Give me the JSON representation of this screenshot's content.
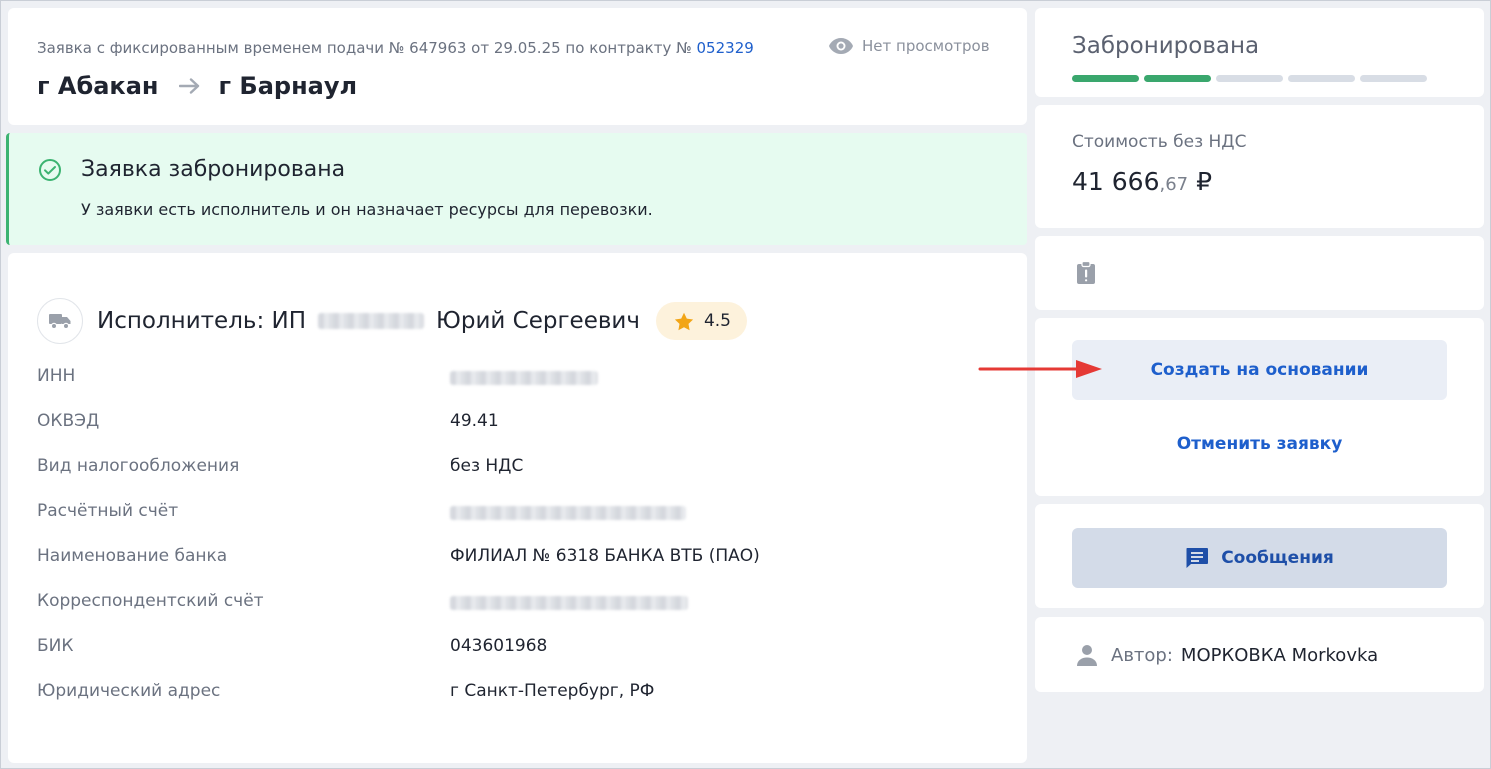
{
  "header": {
    "order_meta": "Заявка с фиксированным временем подачи № 647963 от 29.05.25 по контракту №",
    "contract_number": "052329",
    "views": "Нет просмотров",
    "route_from": "г Абакан",
    "route_to": "г Барнаул"
  },
  "status_banner": {
    "title": "Заявка забронирована",
    "description": "У заявки есть исполнитель и он назначает ресурсы для перевозки."
  },
  "executor": {
    "name_prefix": "Исполнитель: ИП",
    "name_suffix": "Юрий Сергеевич",
    "rating": "4.5",
    "properties": [
      {
        "label": "ИНН",
        "value": ""
      },
      {
        "label": "ОКВЭД",
        "value": "49.41"
      },
      {
        "label": "Вид налогообложения",
        "value": "без НДС"
      },
      {
        "label": "Расчётный счёт",
        "value": ""
      },
      {
        "label": "Наименование банка",
        "value": "ФИЛИАЛ № 6318 БАНКА ВТБ (ПАО)"
      },
      {
        "label": "Корреспондентский счёт",
        "value": ""
      },
      {
        "label": "БИК",
        "value": "043601968"
      },
      {
        "label": "Юридический адрес",
        "value": "г Санкт-Петербург, РФ"
      }
    ]
  },
  "status_panel": {
    "status": "Забронирована",
    "progress_steps_total": 5,
    "progress_steps_done": 2,
    "done_color": "#3aa76d",
    "pending_color": "#d8dde5"
  },
  "price": {
    "label": "Стоимость без НДС",
    "rubles": "41 666",
    "kopecks": ",67",
    "currency": "₽"
  },
  "actions": {
    "create_label": "Создать на основании",
    "cancel_label": "Отменить заявку"
  },
  "messages": {
    "label": "Сообщения"
  },
  "author": {
    "label": "Автор:",
    "name": "МОРКОВКА Morkovka"
  },
  "icons": {
    "views": "eye-icon",
    "route": "arrow-right-icon",
    "banner": "check-circle-icon",
    "executor": "truck-icon",
    "rating": "star-icon",
    "clipboard": "clipboard-alert-icon",
    "messages": "chat-icon",
    "author": "person-icon",
    "annotation": "red-arrow-annotation"
  },
  "colors": {
    "accent": "#1e5fcc",
    "success": "#3cb371",
    "banner_bg": "#e6fbf0",
    "annotation": "#e53935"
  }
}
